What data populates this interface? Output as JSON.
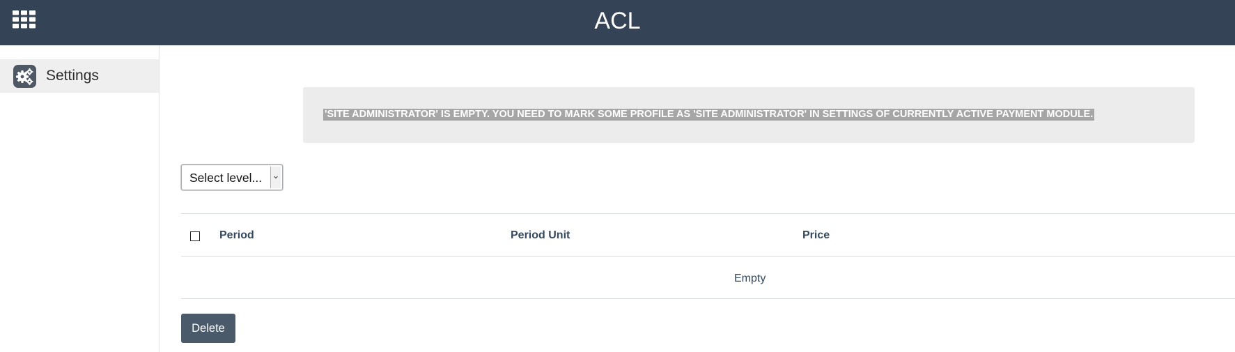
{
  "header": {
    "title": "ACL",
    "apps_icon": "grid-icon"
  },
  "sidebar": {
    "items": [
      {
        "label": "Settings",
        "icon": "settings-gears-icon"
      }
    ]
  },
  "alert": {
    "message": "'SITE ADMINISTRATOR' IS EMPTY. YOU NEED TO MARK SOME PROFILE AS 'SITE ADMINISTRATOR' IN SETTINGS OF CURRENTLY ACTIVE PAYMENT MODULE."
  },
  "level_select": {
    "selected": "Select level..."
  },
  "table": {
    "columns": [
      "Period",
      "Period Unit",
      "Price"
    ],
    "empty_text": "Empty"
  },
  "actions": {
    "delete_label": "Delete"
  }
}
